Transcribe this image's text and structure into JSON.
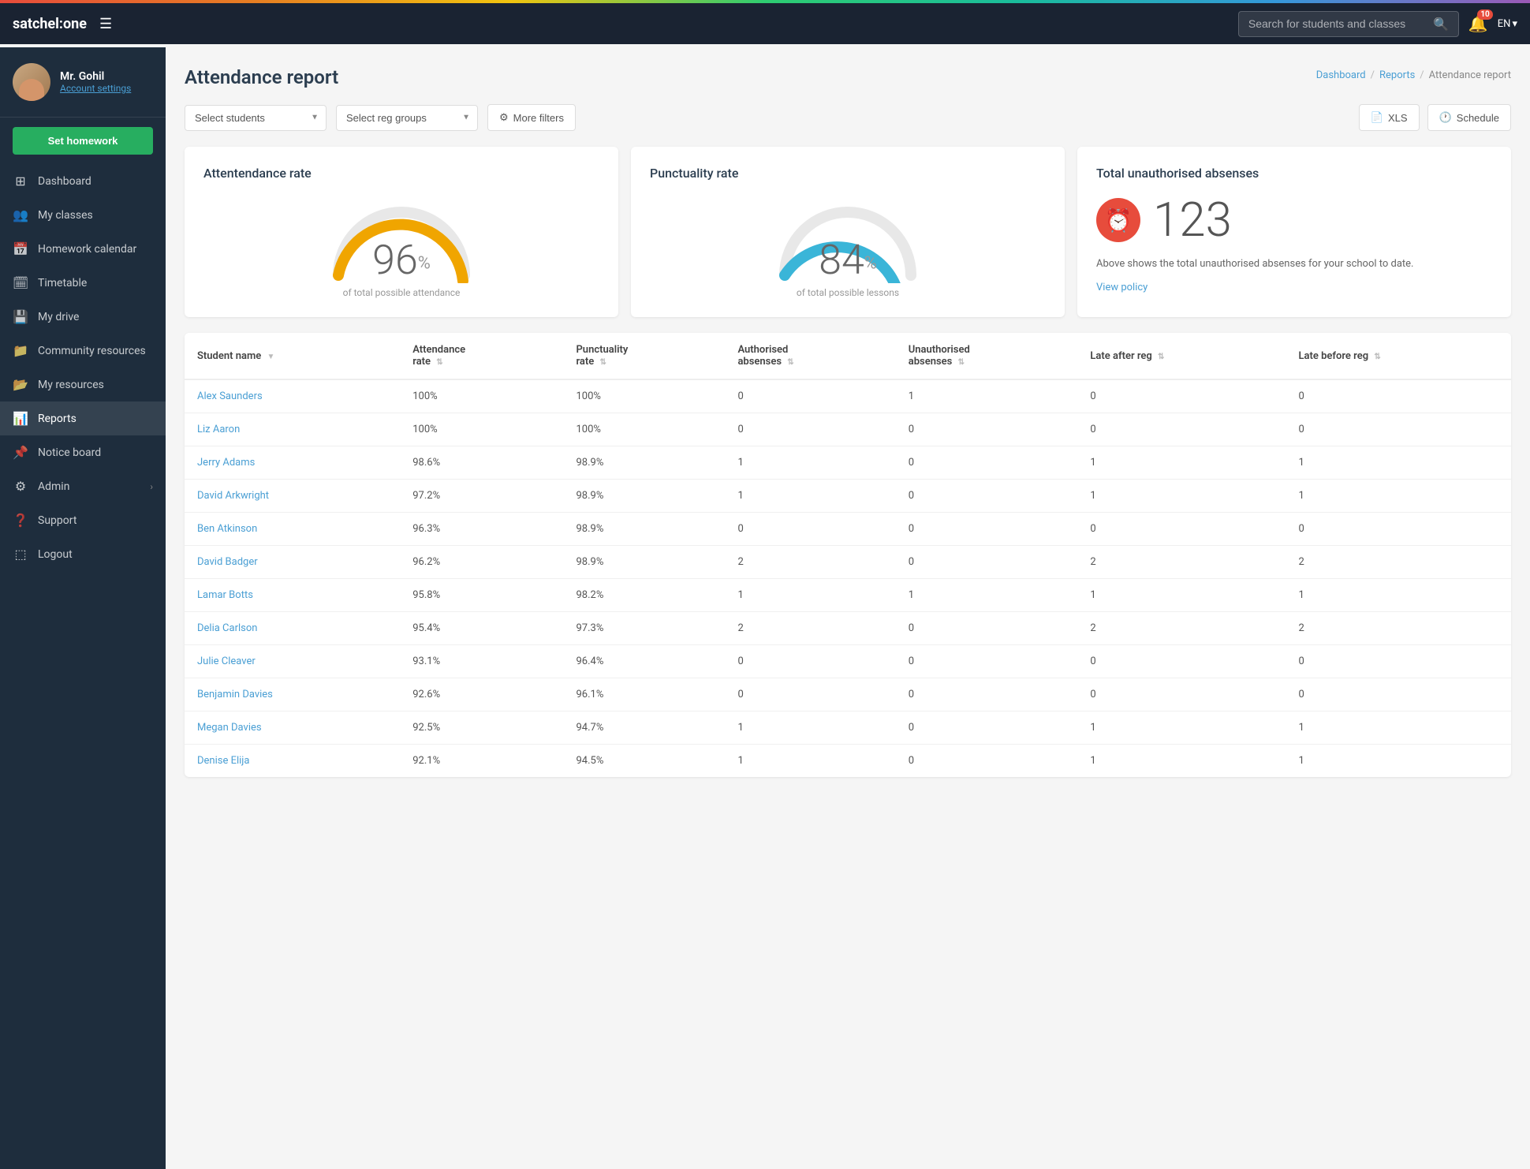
{
  "topbar": {
    "logo": "satchel:one",
    "hamburger_label": "☰",
    "search_placeholder": "Search for students and classes",
    "bell_count": "10",
    "lang": "EN"
  },
  "sidebar": {
    "user": {
      "name": "Mr. Gohil",
      "settings_label": "Account settings"
    },
    "set_homework_label": "Set homework",
    "nav_items": [
      {
        "id": "dashboard",
        "label": "Dashboard",
        "icon": "⊞"
      },
      {
        "id": "my-classes",
        "label": "My classes",
        "icon": "👥"
      },
      {
        "id": "homework-calendar",
        "label": "Homework calendar",
        "icon": "📅"
      },
      {
        "id": "timetable",
        "label": "Timetable",
        "icon": "🗓"
      },
      {
        "id": "my-drive",
        "label": "My drive",
        "icon": "💾"
      },
      {
        "id": "community-resources",
        "label": "Community resources",
        "icon": "📁"
      },
      {
        "id": "my-resources",
        "label": "My resources",
        "icon": "📂"
      },
      {
        "id": "reports",
        "label": "Reports",
        "icon": "📊",
        "active": true
      },
      {
        "id": "notice-board",
        "label": "Notice board",
        "icon": "📌"
      },
      {
        "id": "admin",
        "label": "Admin",
        "icon": "⚙",
        "has_arrow": true
      },
      {
        "id": "support",
        "label": "Support",
        "icon": "❓"
      },
      {
        "id": "logout",
        "label": "Logout",
        "icon": "⬚"
      }
    ]
  },
  "page": {
    "title": "Attendance report",
    "breadcrumb": {
      "items": [
        "Dashboard",
        "Reports",
        "Attendance report"
      ],
      "separator": "/"
    }
  },
  "filters": {
    "select_students_placeholder": "Select students",
    "select_reg_groups_placeholder": "Select reg groups",
    "more_filters_label": "More filters",
    "xls_label": "XLS",
    "schedule_label": "Schedule"
  },
  "attendance_card": {
    "title": "Attentendance rate",
    "value": "96",
    "suffix": "%",
    "subtitle": "of total possible attendance",
    "gauge_color": "#f0a500",
    "track_color": "#e0e0e0",
    "percentage": 96
  },
  "punctuality_card": {
    "title": "Punctuality rate",
    "value": "84",
    "suffix": "%",
    "subtitle": "of total possible lessons",
    "gauge_color": "#3ab5d8",
    "track_color": "#e0e0e0",
    "percentage": 84
  },
  "unauth_card": {
    "title": "Total unauthorised absenses",
    "value": "123",
    "description": "Above shows the total unauthorised absenses for your school to date.",
    "view_policy_label": "View policy",
    "icon": "⏰"
  },
  "table": {
    "columns": [
      {
        "id": "name",
        "label": "Student name",
        "sortable": true,
        "active_sort": true
      },
      {
        "id": "attendance_rate",
        "label": "Attendance rate",
        "sortable": true
      },
      {
        "id": "punctuality_rate",
        "label": "Punctuality rate",
        "sortable": true
      },
      {
        "id": "authorised_absenses",
        "label": "Authorised absenses",
        "sortable": true
      },
      {
        "id": "unauthorised_absenses",
        "label": "Unauthorised absenses",
        "sortable": true
      },
      {
        "id": "late_after_reg",
        "label": "Late after reg",
        "sortable": true
      },
      {
        "id": "late_before_reg",
        "label": "Late before reg",
        "sortable": true
      }
    ],
    "rows": [
      {
        "name": "Alex Saunders",
        "attendance_rate": "100%",
        "punctuality_rate": "100%",
        "authorised": "0",
        "unauthorised": "1",
        "late_after": "0",
        "late_before": "0"
      },
      {
        "name": "Liz Aaron",
        "attendance_rate": "100%",
        "punctuality_rate": "100%",
        "authorised": "0",
        "unauthorised": "0",
        "late_after": "0",
        "late_before": "0"
      },
      {
        "name": "Jerry Adams",
        "attendance_rate": "98.6%",
        "punctuality_rate": "98.9%",
        "authorised": "1",
        "unauthorised": "0",
        "late_after": "1",
        "late_before": "1"
      },
      {
        "name": "David Arkwright",
        "attendance_rate": "97.2%",
        "punctuality_rate": "98.9%",
        "authorised": "1",
        "unauthorised": "0",
        "late_after": "1",
        "late_before": "1"
      },
      {
        "name": "Ben Atkinson",
        "attendance_rate": "96.3%",
        "punctuality_rate": "98.9%",
        "authorised": "0",
        "unauthorised": "0",
        "late_after": "0",
        "late_before": "0"
      },
      {
        "name": "David Badger",
        "attendance_rate": "96.2%",
        "punctuality_rate": "98.9%",
        "authorised": "2",
        "unauthorised": "0",
        "late_after": "2",
        "late_before": "2"
      },
      {
        "name": "Lamar Botts",
        "attendance_rate": "95.8%",
        "punctuality_rate": "98.2%",
        "authorised": "1",
        "unauthorised": "1",
        "late_after": "1",
        "late_before": "1"
      },
      {
        "name": "Delia Carlson",
        "attendance_rate": "95.4%",
        "punctuality_rate": "97.3%",
        "authorised": "2",
        "unauthorised": "0",
        "late_after": "2",
        "late_before": "2"
      },
      {
        "name": "Julie Cleaver",
        "attendance_rate": "93.1%",
        "punctuality_rate": "96.4%",
        "authorised": "0",
        "unauthorised": "0",
        "late_after": "0",
        "late_before": "0"
      },
      {
        "name": "Benjamin Davies",
        "attendance_rate": "92.6%",
        "punctuality_rate": "96.1%",
        "authorised": "0",
        "unauthorised": "0",
        "late_after": "0",
        "late_before": "0"
      },
      {
        "name": "Megan Davies",
        "attendance_rate": "92.5%",
        "punctuality_rate": "94.7%",
        "authorised": "1",
        "unauthorised": "0",
        "late_after": "1",
        "late_before": "1"
      },
      {
        "name": "Denise Elija",
        "attendance_rate": "92.1%",
        "punctuality_rate": "94.5%",
        "authorised": "1",
        "unauthorised": "0",
        "late_after": "1",
        "late_before": "1"
      }
    ]
  }
}
